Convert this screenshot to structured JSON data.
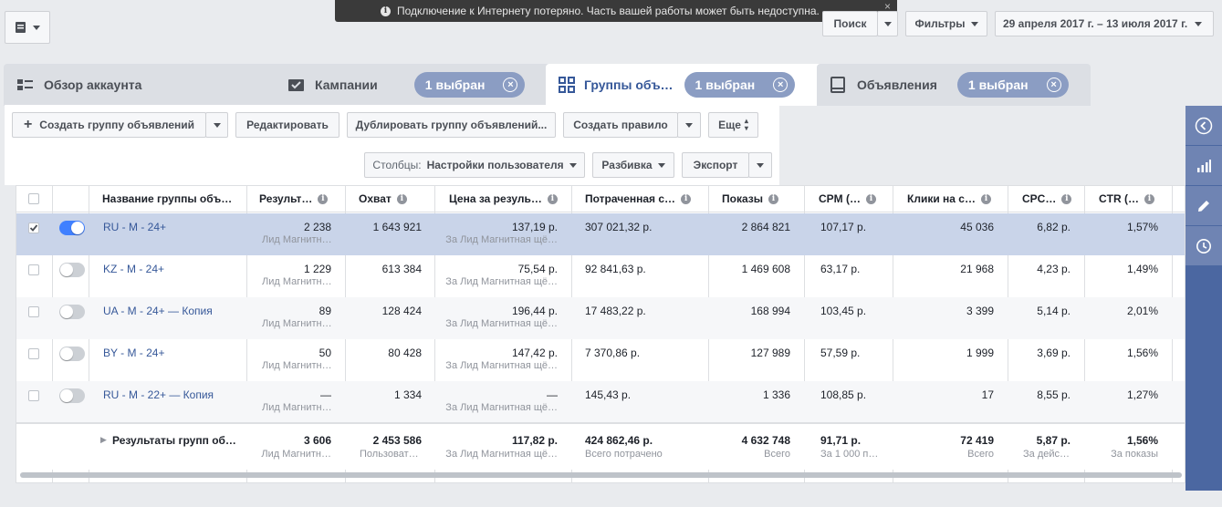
{
  "toast": {
    "message": "Подключение к Интернету потеряно. Часть вашей работы может быть недоступна.",
    "close": "×"
  },
  "topbar": {
    "search_label": "Поиск",
    "filters_label": "Фильтры",
    "date_range": "29 апреля 2017 г. – 13 июля 2017 г."
  },
  "tabs": [
    {
      "label": "Обзор аккаунта",
      "icon": "account-overview-icon"
    },
    {
      "label": "Кампании",
      "icon": "campaign-check-icon",
      "pill": "1 выбран"
    },
    {
      "label": "Группы объ…",
      "icon": "grid-icon",
      "pill": "1 выбран",
      "active": true
    },
    {
      "label": "Объявления",
      "icon": "ad-icon",
      "pill": "1 выбран"
    }
  ],
  "toolbar": {
    "create": "Создать группу объявлений",
    "edit": "Редактировать",
    "duplicate": "Дублировать группу объявлений...",
    "create_rule": "Создать правило",
    "more": "Еще",
    "columns_prefix": "Столбцы:",
    "columns_value": "Настройки пользователя",
    "breakdown": "Разбивка",
    "export": "Экспорт"
  },
  "table": {
    "headers": [
      "Название группы объ…",
      "Результ…",
      "Охват",
      "Цена за резуль…",
      "Потраченная с…",
      "Показы",
      "CPM (…",
      "Клики на с…",
      "CPC…",
      "CTR (…"
    ],
    "rows": [
      {
        "name": "RU - M - 24+",
        "selected": true,
        "on": true,
        "results": "2 238",
        "results_sub": "Лид Магнитн…",
        "reach": "1 643 921",
        "cpr": "137,19 р.",
        "cpr_sub": "За Лид Магнитная щё…",
        "spent": "307 021,32 р.",
        "impr": "2 864 821",
        "cpm": "107,17 р.",
        "clicks": "45 036",
        "cpc": "6,82 р.",
        "ctr": "1,57%"
      },
      {
        "name": "KZ - M - 24+",
        "selected": false,
        "on": false,
        "results": "1 229",
        "results_sub": "Лид Магнитн…",
        "reach": "613 384",
        "cpr": "75,54 р.",
        "cpr_sub": "За Лид Магнитная щё…",
        "spent": "92 841,63 р.",
        "impr": "1 469 608",
        "cpm": "63,17 р.",
        "clicks": "21 968",
        "cpc": "4,23 р.",
        "ctr": "1,49%"
      },
      {
        "name": "UA - M - 24+ — Копия",
        "selected": false,
        "on": false,
        "results": "89",
        "results_sub": "Лид Магнитн…",
        "reach": "128 424",
        "cpr": "196,44 р.",
        "cpr_sub": "За Лид Магнитная щё…",
        "spent": "17 483,22 р.",
        "impr": "168 994",
        "cpm": "103,45 р.",
        "clicks": "3 399",
        "cpc": "5,14 р.",
        "ctr": "2,01%"
      },
      {
        "name": "BY - M - 24+",
        "selected": false,
        "on": false,
        "results": "50",
        "results_sub": "Лид Магнитн…",
        "reach": "80 428",
        "cpr": "147,42 р.",
        "cpr_sub": "За Лид Магнитная щё…",
        "spent": "7 370,86 р.",
        "impr": "127 989",
        "cpm": "57,59 р.",
        "clicks": "1 999",
        "cpc": "3,69 р.",
        "ctr": "1,56%"
      },
      {
        "name": "RU - M - 22+ — Копия",
        "selected": false,
        "on": false,
        "results": "—",
        "results_sub": "Лид Магнитн…",
        "reach": "1 334",
        "cpr": "—",
        "cpr_sub": "За Лид Магнитная щё…",
        "spent": "145,43 р.",
        "impr": "1 336",
        "cpm": "108,85 р.",
        "clicks": "17",
        "cpc": "8,55 р.",
        "ctr": "1,27%"
      }
    ],
    "totals": {
      "name": "Результаты групп об…",
      "results": "3 606",
      "results_sub": "Лид Магнитн…",
      "reach": "2 453 586",
      "reach_sub": "Пользоват…",
      "cpr": "117,82 р.",
      "cpr_sub": "За Лид Магнитная щё…",
      "spent": "424 862,46 р.",
      "spent_sub": "Всего потрачено",
      "impr": "4 632 748",
      "impr_sub": "Всего",
      "cpm": "91,71 р.",
      "cpm_sub": "За 1 000 п…",
      "clicks": "72 419",
      "clicks_sub": "Всего",
      "cpc": "5,87 р.",
      "cpc_sub": "За дейс…",
      "ctr": "1,56%",
      "ctr_sub": "За показы"
    }
  },
  "colors": {
    "accent": "#4080ff",
    "link": "#365899",
    "pill": "#8b9dc3",
    "rail": "#4b67a1"
  }
}
